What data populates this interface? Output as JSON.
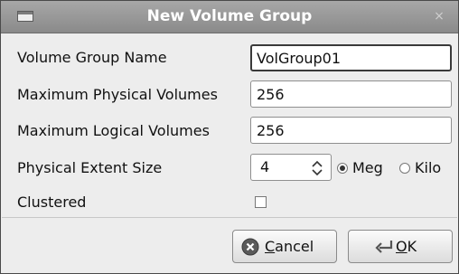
{
  "window": {
    "title": "New Volume Group",
    "close_glyph": "×"
  },
  "form": {
    "name_label": "Volume Group Name",
    "name_value": "VolGroup01",
    "max_pv_label": "Maximum Physical Volumes",
    "max_pv_value": "256",
    "max_lv_label": "Maximum Logical Volumes",
    "max_lv_value": "256",
    "extent_label": "Physical Extent Size",
    "extent_value": "4",
    "unit_options": [
      "Meg",
      "Kilo"
    ],
    "unit_selected": "Meg",
    "clustered_label": "Clustered",
    "clustered_checked": false
  },
  "buttons": {
    "cancel_label": "Cancel",
    "ok_label": "OK"
  },
  "icons": {
    "window_menu": "window-menu-icon",
    "close": "close-icon",
    "spin": "spin-up-down-icon",
    "cancel": "cancel-icon",
    "ok": "ok-icon"
  }
}
